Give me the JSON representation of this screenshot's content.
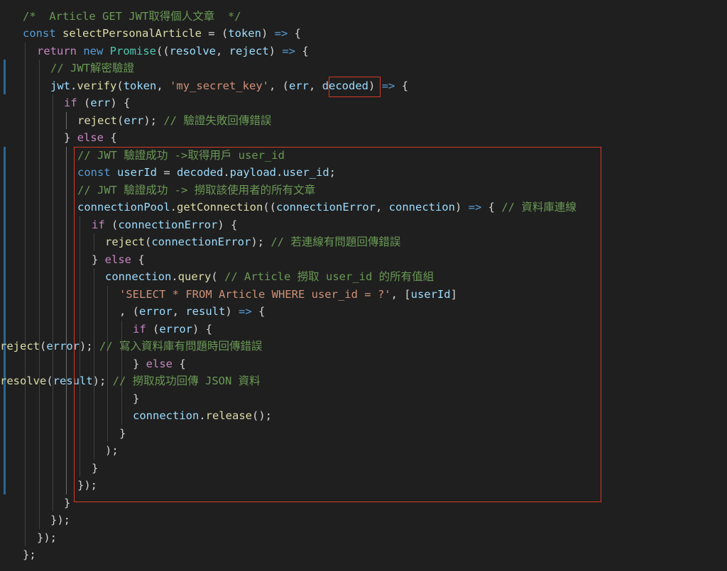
{
  "editor": {
    "language": "javascript",
    "highlight_color": "#d63a28",
    "lines": [
      [
        {
          "c": "t-cmt",
          "t": "/*  Article GET JWT取得個人文章  */"
        }
      ],
      [
        {
          "c": "t-kw",
          "t": "const "
        },
        {
          "c": "t-fn",
          "t": "selectPersonalArticle"
        },
        {
          "c": "t-op",
          "t": " = ("
        },
        {
          "c": "t-var",
          "t": "token"
        },
        {
          "c": "t-op",
          "t": ") "
        },
        {
          "c": "t-kw",
          "t": "=>"
        },
        {
          "c": "t-op",
          "t": " {"
        }
      ],
      [
        {
          "c": "t-ctl",
          "t": "return "
        },
        {
          "c": "t-kw",
          "t": "new "
        },
        {
          "c": "t-cls",
          "t": "Promise"
        },
        {
          "c": "t-op",
          "t": "(("
        },
        {
          "c": "t-var",
          "t": "resolve"
        },
        {
          "c": "t-op",
          "t": ", "
        },
        {
          "c": "t-var",
          "t": "reject"
        },
        {
          "c": "t-op",
          "t": ") "
        },
        {
          "c": "t-kw",
          "t": "=>"
        },
        {
          "c": "t-op",
          "t": " {"
        }
      ],
      [
        {
          "c": "t-cmt",
          "t": "// JWT解密驗證"
        }
      ],
      [
        {
          "c": "t-var",
          "t": "jwt"
        },
        {
          "c": "t-op",
          "t": "."
        },
        {
          "c": "t-fn",
          "t": "verify"
        },
        {
          "c": "t-op",
          "t": "("
        },
        {
          "c": "t-var",
          "t": "token"
        },
        {
          "c": "t-op",
          "t": ", "
        },
        {
          "c": "t-str",
          "t": "'my_secret_key'"
        },
        {
          "c": "t-op",
          "t": ", ("
        },
        {
          "c": "t-var",
          "t": "err"
        },
        {
          "c": "t-op",
          "t": ", "
        },
        {
          "c": "t-var",
          "t": "decoded"
        },
        {
          "c": "t-op",
          "t": ") "
        },
        {
          "c": "t-kw",
          "t": "=>"
        },
        {
          "c": "t-op",
          "t": " {"
        }
      ],
      [
        {
          "c": "t-ctl",
          "t": "if "
        },
        {
          "c": "t-op",
          "t": "("
        },
        {
          "c": "t-var",
          "t": "err"
        },
        {
          "c": "t-op",
          "t": ") {"
        }
      ],
      [
        {
          "c": "t-fn",
          "t": "reject"
        },
        {
          "c": "t-op",
          "t": "("
        },
        {
          "c": "t-var",
          "t": "err"
        },
        {
          "c": "t-op",
          "t": "); "
        },
        {
          "c": "t-cmt",
          "t": "// 驗證失敗回傳錯誤"
        }
      ],
      [
        {
          "c": "t-op",
          "t": "} "
        },
        {
          "c": "t-ctl",
          "t": "else"
        },
        {
          "c": "t-op",
          "t": " {"
        }
      ],
      [
        {
          "c": "t-cmt",
          "t": "// JWT 驗證成功 ->取得用戶 user_id"
        }
      ],
      [
        {
          "c": "t-kw",
          "t": "const "
        },
        {
          "c": "t-var",
          "t": "userId"
        },
        {
          "c": "t-op",
          "t": " = "
        },
        {
          "c": "t-var",
          "t": "decoded"
        },
        {
          "c": "t-op",
          "t": "."
        },
        {
          "c": "t-var",
          "t": "payload"
        },
        {
          "c": "t-op",
          "t": "."
        },
        {
          "c": "t-var",
          "t": "user_id"
        },
        {
          "c": "t-op",
          "t": ";"
        }
      ],
      [
        {
          "c": "t-cmt",
          "t": "// JWT 驗證成功 -> 撈取該使用者的所有文章"
        }
      ],
      [
        {
          "c": "t-var",
          "t": "connectionPool"
        },
        {
          "c": "t-op",
          "t": "."
        },
        {
          "c": "t-fn",
          "t": "getConnection"
        },
        {
          "c": "t-op",
          "t": "(("
        },
        {
          "c": "t-var",
          "t": "connectionError"
        },
        {
          "c": "t-op",
          "t": ", "
        },
        {
          "c": "t-var",
          "t": "connection"
        },
        {
          "c": "t-op",
          "t": ") "
        },
        {
          "c": "t-kw",
          "t": "=>"
        },
        {
          "c": "t-op",
          "t": " { "
        },
        {
          "c": "t-cmt",
          "t": "// 資料庫連線"
        }
      ],
      [
        {
          "c": "t-ctl",
          "t": "if "
        },
        {
          "c": "t-op",
          "t": "("
        },
        {
          "c": "t-var",
          "t": "connectionError"
        },
        {
          "c": "t-op",
          "t": ") {"
        }
      ],
      [
        {
          "c": "t-fn",
          "t": "reject"
        },
        {
          "c": "t-op",
          "t": "("
        },
        {
          "c": "t-var",
          "t": "connectionError"
        },
        {
          "c": "t-op",
          "t": "); "
        },
        {
          "c": "t-cmt",
          "t": "// 若連線有問題回傳錯誤"
        }
      ],
      [
        {
          "c": "t-op",
          "t": "} "
        },
        {
          "c": "t-ctl",
          "t": "else"
        },
        {
          "c": "t-op",
          "t": " {"
        }
      ],
      [
        {
          "c": "t-var",
          "t": "connection"
        },
        {
          "c": "t-op",
          "t": "."
        },
        {
          "c": "t-fn",
          "t": "query"
        },
        {
          "c": "t-op",
          "t": "( "
        },
        {
          "c": "t-cmt",
          "t": "// Article 撈取 user_id 的所有值組"
        }
      ],
      [
        {
          "c": "t-str",
          "t": "'SELECT * FROM Article WHERE user_id = ?'"
        },
        {
          "c": "t-op",
          "t": ", ["
        },
        {
          "c": "t-var",
          "t": "userId"
        },
        {
          "c": "t-op",
          "t": "]"
        }
      ],
      [
        {
          "c": "t-op",
          "t": ", ("
        },
        {
          "c": "t-var",
          "t": "error"
        },
        {
          "c": "t-op",
          "t": ", "
        },
        {
          "c": "t-var",
          "t": "result"
        },
        {
          "c": "t-op",
          "t": ") "
        },
        {
          "c": "t-kw",
          "t": "=>"
        },
        {
          "c": "t-op",
          "t": " {"
        }
      ],
      [
        {
          "c": "t-ctl",
          "t": "if "
        },
        {
          "c": "t-op",
          "t": "("
        },
        {
          "c": "t-var",
          "t": "error"
        },
        {
          "c": "t-op",
          "t": ") {"
        }
      ],
      [
        {
          "c": "t-fn",
          "t": "reject"
        },
        {
          "c": "t-op",
          "t": "("
        },
        {
          "c": "t-var",
          "t": "error"
        },
        {
          "c": "t-op",
          "t": "); "
        },
        {
          "c": "t-cmt",
          "t": "// 寫入資料庫有問題時回傳錯誤"
        }
      ],
      [
        {
          "c": "t-op",
          "t": "} "
        },
        {
          "c": "t-ctl",
          "t": "else"
        },
        {
          "c": "t-op",
          "t": " {"
        }
      ],
      [
        {
          "c": "t-fn",
          "t": "resolve"
        },
        {
          "c": "t-op",
          "t": "("
        },
        {
          "c": "t-var",
          "t": "result"
        },
        {
          "c": "t-op",
          "t": "); "
        },
        {
          "c": "t-cmt",
          "t": "// 撈取成功回傳 JSON 資料"
        }
      ],
      [
        {
          "c": "t-op",
          "t": "}"
        }
      ],
      [
        {
          "c": "t-var",
          "t": "connection"
        },
        {
          "c": "t-op",
          "t": "."
        },
        {
          "c": "t-fn",
          "t": "release"
        },
        {
          "c": "t-op",
          "t": "();"
        }
      ],
      [
        {
          "c": "t-op",
          "t": "}"
        }
      ],
      [
        {
          "c": "t-op",
          "t": ");"
        }
      ],
      [
        {
          "c": "t-op",
          "t": "}"
        }
      ],
      [
        {
          "c": "t-op",
          "t": "});"
        }
      ],
      [
        {
          "c": "t-op",
          "t": "}"
        }
      ],
      [
        {
          "c": "t-op",
          "t": "});"
        }
      ],
      [
        {
          "c": "t-op",
          "t": "});"
        }
      ],
      [
        {
          "c": "t-op",
          "t": "};"
        }
      ]
    ]
  }
}
